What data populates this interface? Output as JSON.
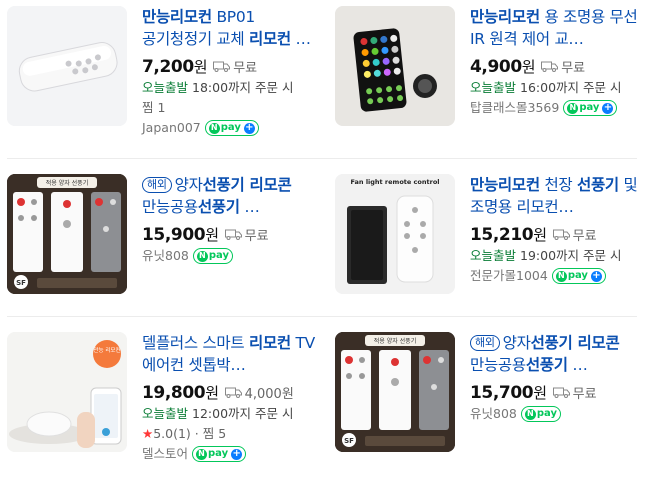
{
  "products": [
    {
      "title_pre": "",
      "title_bold": "만능리모컨",
      "title_rest": " BP01 공기청정기 교체 ",
      "title_bold2": "리모컨",
      "title_end": " …",
      "overseas": "",
      "price": "7,200",
      "won": "원",
      "shipping": "무료",
      "today_label": "오늘출발",
      "today_time": "18:00까지 주문 시",
      "extra": "찜 1",
      "seller": "Japan007",
      "pay": "pay",
      "pay_plus": true
    },
    {
      "title_pre": "",
      "title_bold": "만능리모컨",
      "title_rest": " 용 조명용 무선 IR 원격 제어 교…",
      "title_bold2": "",
      "title_end": "",
      "overseas": "",
      "price": "4,900",
      "won": "원",
      "shipping": "무료",
      "today_label": "오늘출발",
      "today_time": "16:00까지 주문 시",
      "extra": "",
      "seller": "탑클래스몰3569",
      "pay": "pay",
      "pay_plus": true
    },
    {
      "title_pre": "양자",
      "title_bold": "선풍기 리모콘",
      "title_rest": " 만능공용",
      "title_bold2": "선풍기",
      "title_end": " …",
      "overseas": "해외",
      "price": "15,900",
      "won": "원",
      "shipping": "무료",
      "today_label": "",
      "today_time": "",
      "extra": "",
      "seller": "유닛808",
      "pay": "pay",
      "pay_plus": false
    },
    {
      "title_pre": "",
      "title_bold": "만능리모컨",
      "title_rest": " 천장 ",
      "title_bold2": "선풍기",
      "title_end": " 및 조명용 리모컨…",
      "overseas": "",
      "price": "15,210",
      "won": "원",
      "shipping": "무료",
      "today_label": "오늘출발",
      "today_time": "19:00까지 주문 시",
      "extra": "",
      "seller": "전문가몰1004",
      "pay": "pay",
      "pay_plus": true
    },
    {
      "title_pre": "델플러스 스마트 ",
      "title_bold": "리모컨",
      "title_rest": " TV 에어컨 셋톱박…",
      "title_bold2": "",
      "title_end": "",
      "overseas": "",
      "price": "19,800",
      "won": "원",
      "shipping": "4,000원",
      "today_label": "오늘출발",
      "today_time": "12:00까지 주문 시",
      "rating": "5.0(1)",
      "extra": "찜 5",
      "seller": "델스토어",
      "pay": "pay",
      "pay_plus": true
    },
    {
      "title_pre": "양자",
      "title_bold": "선풍기 리모콘",
      "title_rest": " 만능공용",
      "title_bold2": "선풍기",
      "title_end": " …",
      "overseas": "해외",
      "price": "15,700",
      "won": "원",
      "shipping": "무료",
      "today_label": "",
      "today_time": "",
      "extra": "",
      "seller": "유닛808",
      "pay": "pay",
      "pay_plus": false
    }
  ],
  "thumb_texts": {
    "fan_header": "적용 양자 선풍기",
    "ceiling_caption": "Fan light remote control",
    "badge": "만능 리모컨",
    "sf": "SF"
  }
}
